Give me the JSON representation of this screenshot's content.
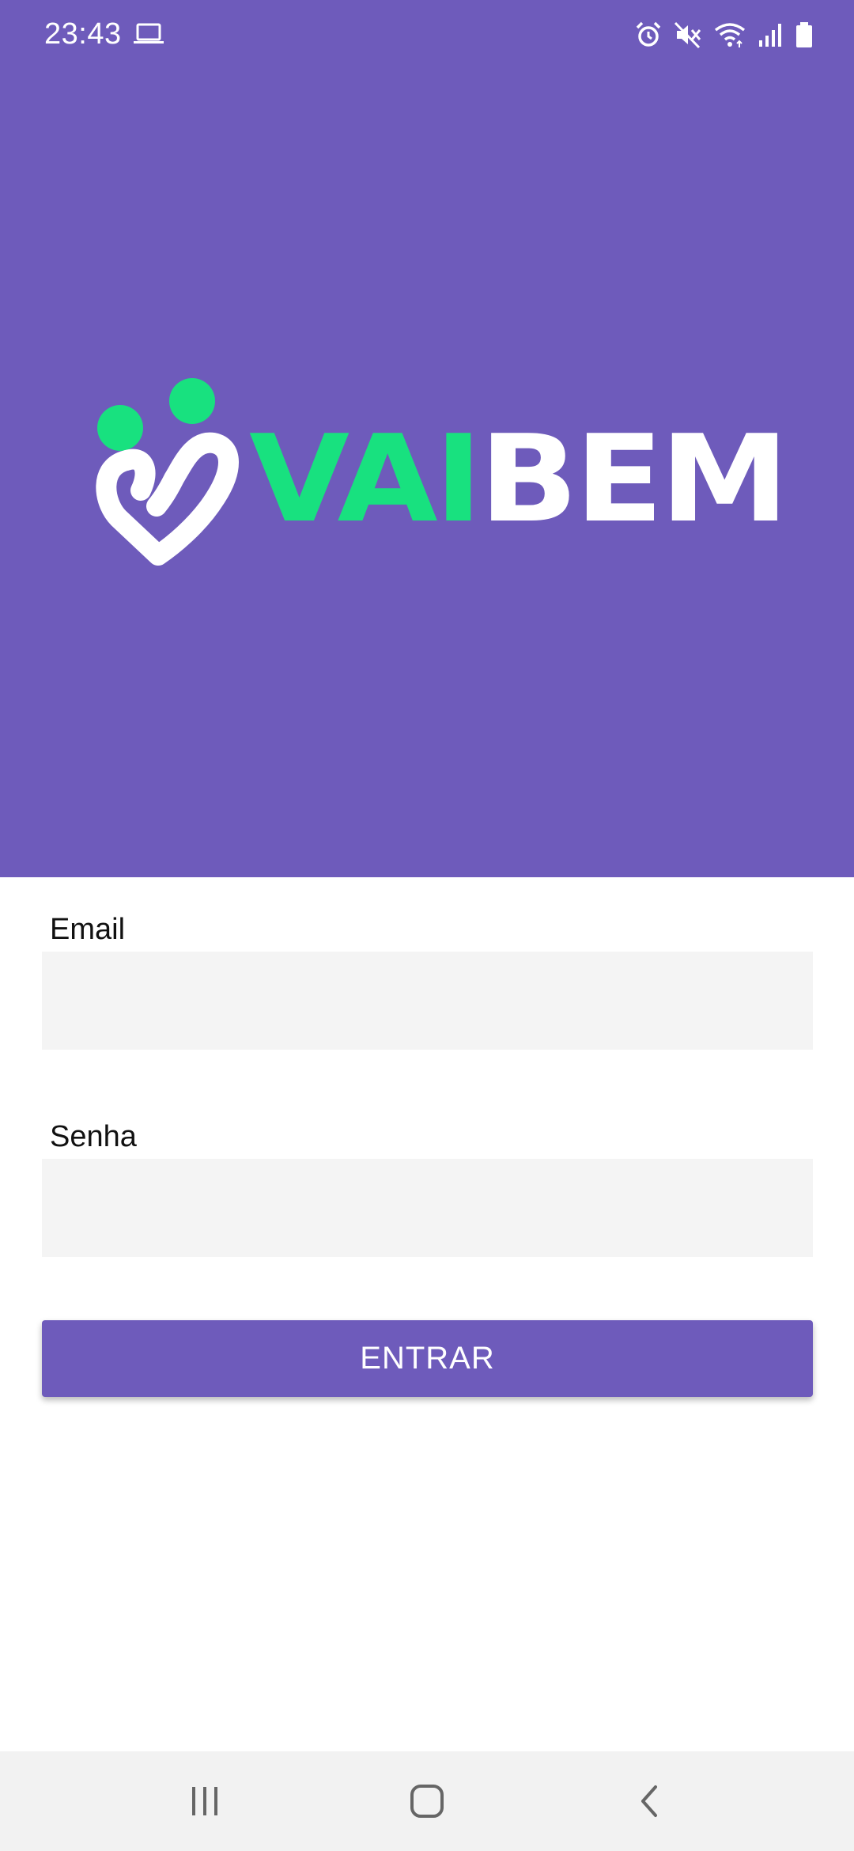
{
  "status_bar": {
    "time": "23:43",
    "icons": [
      "laptop-icon",
      "alarm-icon",
      "mute-icon",
      "wifi-icon",
      "signal-icon",
      "battery-icon"
    ]
  },
  "brand": {
    "logo_text_part1": "VAI",
    "logo_text_part2": "BEM",
    "colors": {
      "primary": "#6e5bbb",
      "accent_green": "#18e17f",
      "logo_white": "#ffffff"
    }
  },
  "form": {
    "email_label": "Email",
    "email_value": "",
    "password_label": "Senha",
    "password_value": "",
    "submit_label": "ENTRAR"
  },
  "nav_bar": {
    "buttons": [
      "recents-icon",
      "home-icon",
      "back-icon"
    ]
  }
}
